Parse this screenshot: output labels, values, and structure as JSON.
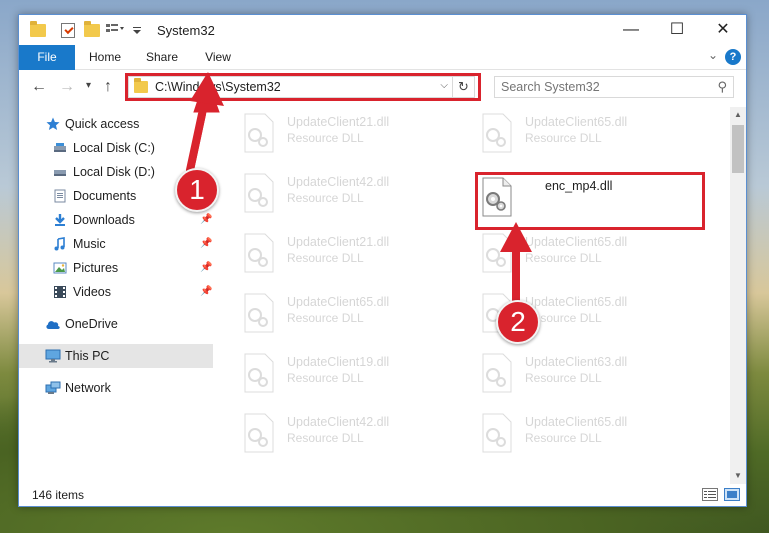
{
  "window": {
    "title": "System32",
    "minimize": "—",
    "maximize": "☐",
    "close": "✕"
  },
  "ribbon": {
    "tabs": [
      {
        "label": "File"
      },
      {
        "label": "Home"
      },
      {
        "label": "Share"
      },
      {
        "label": "View"
      }
    ],
    "help": "?"
  },
  "nav": {
    "address": "C:\\Windows\\System32",
    "search_placeholder": "Search System32"
  },
  "sidebar": {
    "items": [
      {
        "label": "Quick access",
        "icon": "star-icon"
      },
      {
        "label": "Local Disk (C:)",
        "icon": "drive-icon"
      },
      {
        "label": "Local Disk (D:)",
        "icon": "drive-icon"
      },
      {
        "label": "Documents",
        "icon": "document-icon"
      },
      {
        "label": "Downloads",
        "icon": "download-icon"
      },
      {
        "label": "Music",
        "icon": "music-icon"
      },
      {
        "label": "Pictures",
        "icon": "picture-icon"
      },
      {
        "label": "Videos",
        "icon": "video-icon"
      },
      {
        "label": "OneDrive",
        "icon": "cloud-icon"
      },
      {
        "label": "This PC",
        "icon": "computer-icon"
      },
      {
        "label": "Network",
        "icon": "network-icon"
      }
    ]
  },
  "files": {
    "left": [
      {
        "name": "UpdateClient21.dll",
        "type": "Resource DLL"
      },
      {
        "name": "UpdateClient42.dll",
        "type": "Resource DLL"
      },
      {
        "name": "UpdateClient21.dll",
        "type": "Resource DLL"
      },
      {
        "name": "UpdateClient65.dll",
        "type": "Resource DLL"
      },
      {
        "name": "UpdateClient19.dll",
        "type": "Resource DLL"
      },
      {
        "name": "UpdateClient42.dll",
        "type": "Resource DLL"
      }
    ],
    "right": [
      {
        "name": "UpdateClient65.dll",
        "type": "Resource DLL"
      },
      {
        "name": "enc_mp4.dll",
        "type": ""
      },
      {
        "name": "UpdateClient65.dll",
        "type": "Resource DLL"
      },
      {
        "name": "UpdateClient65.dll",
        "type": "Resource DLL"
      },
      {
        "name": "UpdateClient63.dll",
        "type": "Resource DLL"
      },
      {
        "name": "UpdateClient65.dll",
        "type": "Resource DLL"
      }
    ]
  },
  "status": {
    "count": "146 items"
  },
  "callouts": {
    "one": "1",
    "two": "2"
  },
  "colors": {
    "accent": "#1979ca",
    "highlight": "#d9232d"
  }
}
